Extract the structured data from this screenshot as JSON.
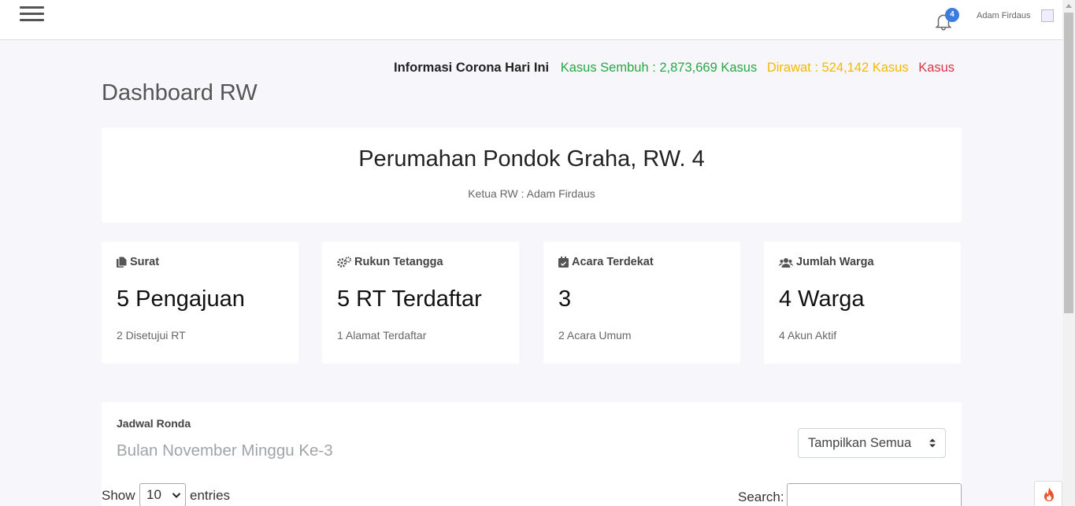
{
  "topbar": {
    "notification_count": "4",
    "user_name": "Adam Firdaus"
  },
  "ticker": {
    "label": "Informasi Corona Hari Ini",
    "sembuh": "Kasus Sembuh : 2,873,669 Kasus",
    "dirawat": "Dirawat : 524,142 Kasus",
    "meninggal": "Kasus"
  },
  "page": {
    "title": "Dashboard RW"
  },
  "hero": {
    "title": "Perumahan Pondok Graha, RW. 4",
    "subtitle": "Ketua RW : Adam Firdaus"
  },
  "cards": [
    {
      "title": "Surat",
      "value": "5 Pengajuan",
      "sub": "2 Disetujui RT",
      "icon": "file-copy-icon"
    },
    {
      "title": "Rukun Tetangga",
      "value": "5 RT Terdaftar",
      "sub": "1 Alamat Terdaftar",
      "icon": "cogs-icon"
    },
    {
      "title": "Acara Terdekat",
      "value": "3",
      "sub": "2 Acara Umum",
      "icon": "calendar-check-icon"
    },
    {
      "title": "Jumlah Warga",
      "value": "4 Warga",
      "sub": "4 Akun Aktif",
      "icon": "users-icon"
    }
  ],
  "jadwal": {
    "label": "Jadwal Ronda",
    "subtitle": "Bulan November Minggu Ke-3",
    "filter_value": "Tampilkan Semua"
  },
  "table_controls": {
    "show_label": "Show",
    "entries_value": "10",
    "entries_label": "entries",
    "search_label": "Search:"
  },
  "colors": {
    "accent": "#3b7ddd",
    "sembuh": "#28a745",
    "dirawat": "#f5b800",
    "meninggal": "#dc3545",
    "background": "#f7f7fb"
  }
}
